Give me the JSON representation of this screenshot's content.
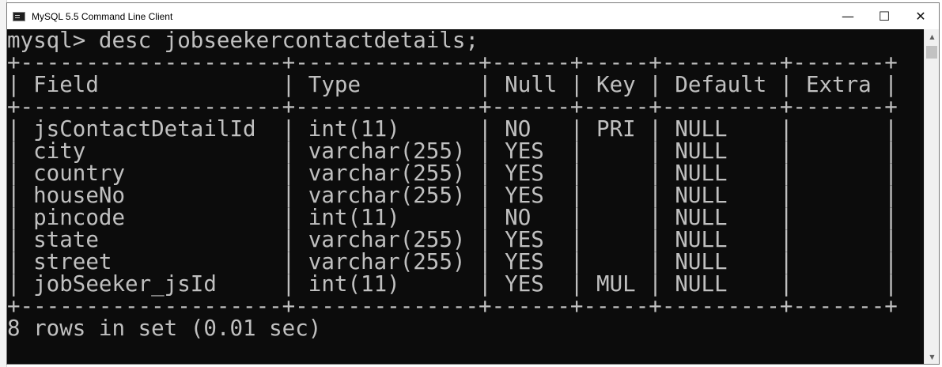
{
  "window": {
    "title": "MySQL 5.5 Command Line Client",
    "minimize_glyph": "—",
    "maximize_glyph": "☐",
    "close_glyph": "✕",
    "icon": "console-app-icon"
  },
  "scrollbar": {
    "up_glyph": "▲",
    "down_glyph": "▼"
  },
  "terminal": {
    "lines": [
      "mysql> desc jobseekercontactdetails;",
      "+--------------------+--------------+------+-----+---------+-------+",
      "| Field              | Type         | Null | Key | Default | Extra |",
      "+--------------------+--------------+------+-----+---------+-------+",
      "| jsContactDetailId  | int(11)      | NO   | PRI | NULL    |       |",
      "| city               | varchar(255) | YES  |     | NULL    |       |",
      "| country            | varchar(255) | YES  |     | NULL    |       |",
      "| houseNo            | varchar(255) | YES  |     | NULL    |       |",
      "| pincode            | int(11)      | NO   |     | NULL    |       |",
      "| state              | varchar(255) | YES  |     | NULL    |       |",
      "| street             | varchar(255) | YES  |     | NULL    |       |",
      "| jobSeeker_jsId     | int(11)      | YES  | MUL | NULL    |       |",
      "+--------------------+--------------+------+-----+---------+-------+",
      "8 rows in set (0.01 sec)"
    ]
  },
  "colors": {
    "terminal_bg": "#0c0c0c",
    "terminal_fg": "#c0c0c0",
    "titlebar_bg": "#ffffff"
  }
}
